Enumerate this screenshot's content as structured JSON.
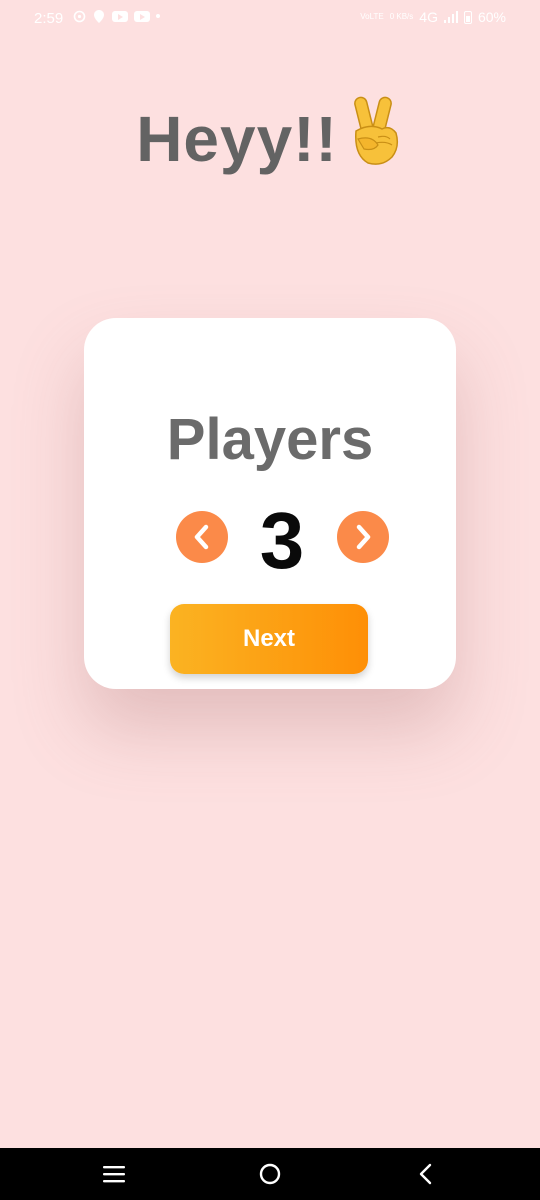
{
  "status_bar": {
    "time": "2:59",
    "network_type": "4G",
    "data_speed": "0 KB/s",
    "volte": "VoLTE",
    "battery": "60%",
    "left_icons": [
      "settings-icon",
      "location-icon",
      "youtube-icon",
      "youtube-icon",
      "dot-icon"
    ]
  },
  "greeting": {
    "text": "Heyy!!",
    "emoji": "✌️"
  },
  "players_card": {
    "title": "Players",
    "count": "3",
    "prev_icon": "chevron-left-icon",
    "next_icon": "chevron-right-icon",
    "next_button_label": "Next"
  },
  "nav_bar": {
    "buttons": [
      "recent-apps-icon",
      "home-icon",
      "back-icon"
    ]
  },
  "colors": {
    "background": "#fde0e0",
    "card": "#ffffff",
    "heading_text": "#636363",
    "arrow_button": "#fb8a49",
    "next_gradient_start": "#fbb322",
    "next_gradient_end": "#fe8f06",
    "count_text": "#0a0a0a"
  }
}
